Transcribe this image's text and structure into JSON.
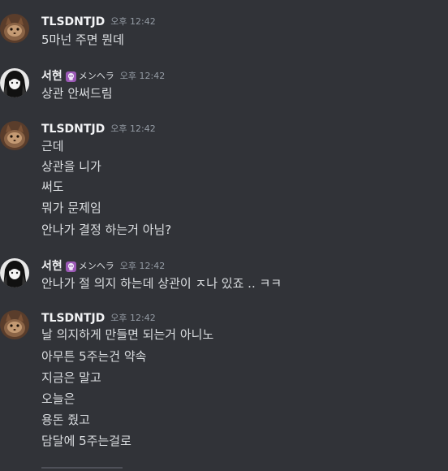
{
  "messages": [
    {
      "username": "TLSDNTJD",
      "timestamp": "오후 12:42",
      "avatar": "cat-avatar-icon",
      "lines": [
        "5마넌 주면 뭔데"
      ]
    },
    {
      "username": "서현",
      "tag": "メンヘラ",
      "tag_icon": "purple-skull-icon",
      "timestamp": "오후 12:42",
      "avatar": "anime-girl-avatar-icon",
      "lines": [
        "상관 안써드림"
      ]
    },
    {
      "username": "TLSDNTJD",
      "timestamp": "오후 12:42",
      "avatar": "cat-avatar-icon",
      "lines": [
        "근데",
        "상관을 니가",
        "써도",
        "뭐가 문제임",
        "안나가 결정 하는거 아님?"
      ]
    },
    {
      "username": "서현",
      "tag": "メンヘラ",
      "tag_icon": "purple-skull-icon",
      "timestamp": "오후 12:42",
      "avatar": "anime-girl-avatar-icon",
      "lines": [
        "안나가 절 의지 하는데 상관이 ㅈ나 있죠 .. ㅋㅋ"
      ]
    },
    {
      "username": "TLSDNTJD",
      "timestamp": "오후 12:42",
      "avatar": "cat-avatar-icon",
      "lines": [
        "날 의지하게 만들면 되는거 아니노",
        "아무튼 5주는건 약속",
        "지금은 말고",
        "오늘은",
        "용돈 줬고",
        "담달에 5주는걸로"
      ]
    }
  ],
  "colors": {
    "background": "#313338",
    "username": "#f2f3f5",
    "message_text": "#dbdee1",
    "timestamp": "#949ba4",
    "tag_icon": "#9b59b6"
  }
}
